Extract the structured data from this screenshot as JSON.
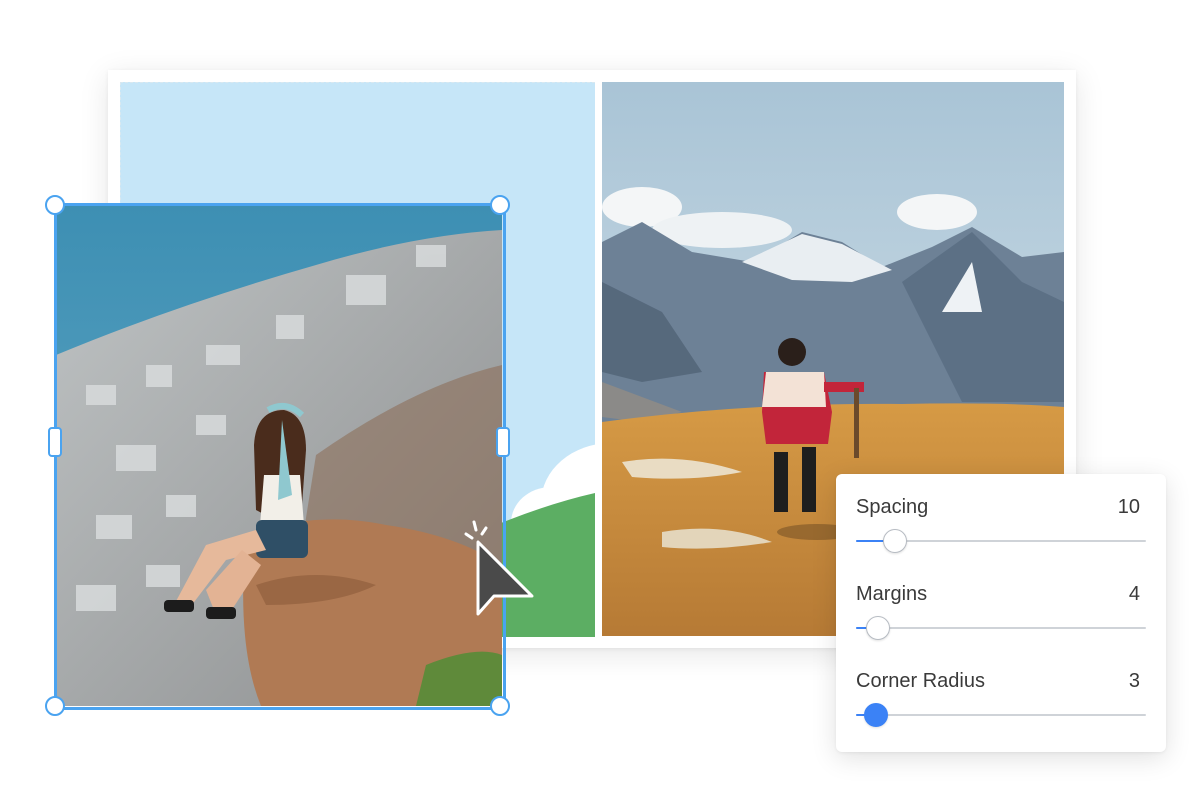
{
  "layout_controls": [
    {
      "label": "Spacing",
      "value": "10",
      "level": 0.135
    },
    {
      "label": "Margins",
      "value": "4",
      "level": 0.075
    },
    {
      "label": "Corner Radius",
      "value": "3",
      "level": 0.07,
      "active": true
    }
  ],
  "colors": {
    "accent": "#3b82f6",
    "selection": "#4aa3f0",
    "slot_background": "#c6e6f8",
    "hill_green": "#5cae63"
  },
  "icons": [
    "cursor-arrow-icon",
    "click-sparkle-icon"
  ]
}
